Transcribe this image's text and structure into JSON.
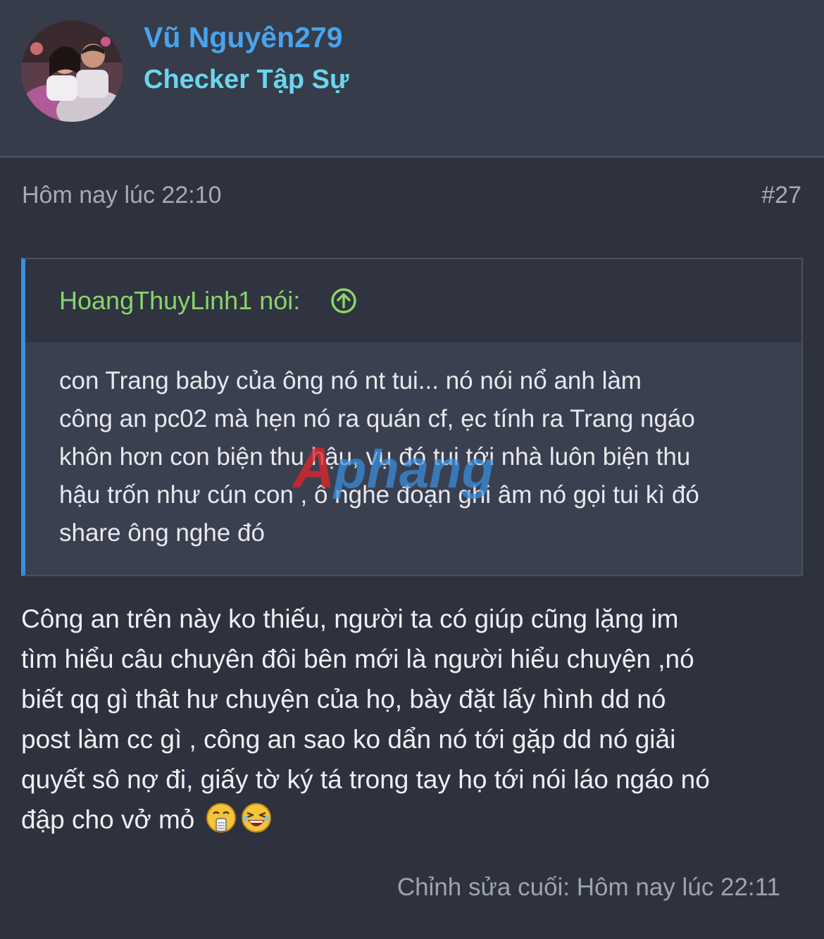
{
  "user": {
    "name": "Vũ Nguyên279",
    "title": "Checker Tập Sự",
    "avatar_icon": "user-avatar-photo"
  },
  "post": {
    "time": "Hôm nay lúc 22:10",
    "number": "#27",
    "body_lines": [
      "Công an trên này ko thiếu, người ta có giúp cũng lặng im",
      "tìm hiểu câu chuyên đôi bên mới là người hiểu chuyện ,nó",
      "biết qq gì thât hư chuyện của họ, bày đặt lấy hình dd nó",
      "post làm cc gì , công an sao ko dẩn nó tới gặp dd nó giải",
      "quyết sô nợ đi, giấy tờ ký tá trong tay họ tới nói láo ngáo nó",
      "đập cho vở mỏ"
    ],
    "emojis": [
      "shocked-face-emoji",
      "laughing-face-emoji"
    ],
    "edit_note": "Chỉnh sửa cuối: Hôm nay lúc 22:11"
  },
  "quote": {
    "author": "HoangThuyLinh1 nói:",
    "jump_icon": "arrow-up-circle-icon",
    "lines": [
      "con Trang baby của ông nó nt tui... nó nói nổ anh làm",
      "công an pc02 mà hẹn nó ra quán cf, ẹc tính ra Trang ngáo",
      "khôn hơn con biện thu hậu, vụ đó tui tới nhà luôn biện thu",
      "hậu trốn như cún con , ô nghe đoạn ghi âm nó gọi tui kì đó",
      "share ông nghe đó"
    ]
  },
  "watermark": {
    "text": "Aphang"
  },
  "colors": {
    "background": "#2d323e",
    "header_bg": "#363c49",
    "username": "#4aa3ec",
    "user_title": "#6ad6ee",
    "quote_author": "#8bd46a",
    "quote_border": "#3a8fe0"
  }
}
